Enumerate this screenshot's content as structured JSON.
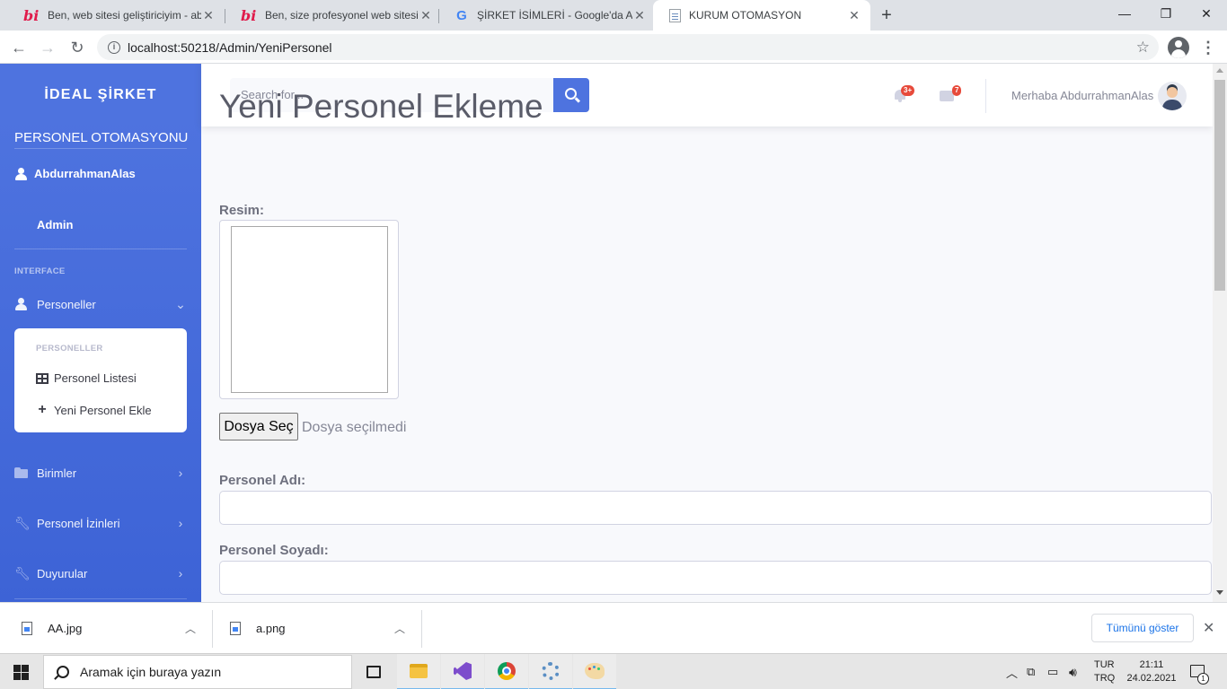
{
  "browser": {
    "tabs": [
      {
        "title": "Ben, web sitesi geliştiriciyim - abdurra",
        "favicon": "bionluk-icon"
      },
      {
        "title": "Ben, size profesyonel web sitesi hazırla",
        "favicon": "bionluk-icon"
      },
      {
        "title": "ŞİRKET İSİMLERİ - Google'da Ara",
        "favicon": "google-icon"
      },
      {
        "title": "KURUM OTOMASYON",
        "favicon": "document-icon"
      }
    ],
    "url": "localhost:50218/Admin/YeniPersonel",
    "controls": {
      "minimize": "—",
      "maximize": "❐",
      "close": "✕",
      "new_tab": "+"
    }
  },
  "sidebar": {
    "brand": "İDEAL ŞİRKET",
    "title": "PERSONEL OTOMASYONU",
    "user": "AbdurrahmanAlas",
    "role": "Admin",
    "heading": "INTERFACE",
    "menu": {
      "personeller": "Personeller",
      "birimler": "Birimler",
      "izinler": "Personel İzinleri",
      "duyurular": "Duyurular"
    },
    "submenu": {
      "heading": "PERSONELLER",
      "list": "Personel Listesi",
      "add": "Yeni Personel Ekle"
    }
  },
  "topbar": {
    "search_placeholder": "Search for...",
    "alerts_badge": "3+",
    "messages_badge": "7",
    "greeting": "Merhaba AbdurrahmanAlas"
  },
  "content": {
    "title": "Yeni Personel Ekleme",
    "image_label": "Resim:",
    "file_button": "Dosya Seç",
    "file_status": "Dosya seçilmedi",
    "first_name_label": "Personel Adı:",
    "last_name_label": "Personel Soyadı:"
  },
  "downloads": {
    "items": [
      {
        "name": "AA.jpg"
      },
      {
        "name": "a.png"
      }
    ],
    "show_all": "Tümünü göster"
  },
  "taskbar": {
    "search_placeholder": "Aramak için buraya yazın",
    "lang_top": "TUR",
    "lang_bottom": "TRQ",
    "time": "21:11",
    "date": "24.02.2021",
    "notification_count": "1"
  },
  "colors": {
    "sidebar": "#4e73df",
    "badge": "#e74a3b",
    "text_muted": "#858796"
  }
}
